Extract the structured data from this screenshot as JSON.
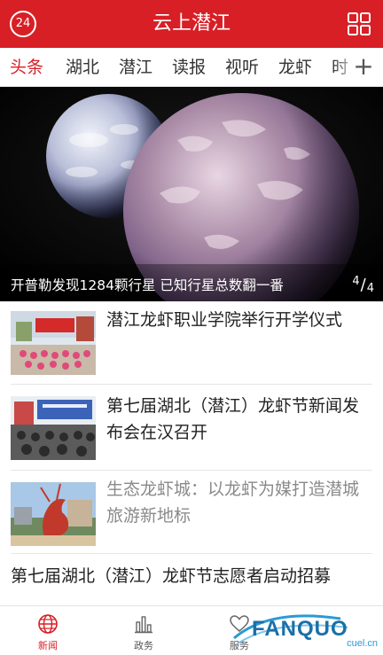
{
  "header": {
    "title": "云上潜江",
    "badge": "24"
  },
  "tabs": [
    "头条",
    "湖北",
    "潜江",
    "读报",
    "视听",
    "龙虾",
    "时"
  ],
  "banner": {
    "caption": "开普勒发现1284颗行星 已知行星总数翻一番",
    "page_current": "4",
    "page_total": "4"
  },
  "news": [
    {
      "title": "潜江龙虾职业学院举行开学仪式"
    },
    {
      "title": "第七届湖北（潜江）龙虾节新闻发布会在汉召开"
    },
    {
      "title": "生态龙虾城：以龙虾为媒打造潜城旅游新地标"
    },
    {
      "title": "第七届湖北（潜江）龙虾节志愿者启动招募"
    }
  ],
  "bottom_nav": [
    {
      "label": "新闻",
      "icon": "globe-icon",
      "active": true
    },
    {
      "label": "政务",
      "icon": "bar-chart-icon",
      "active": false
    },
    {
      "label": "服务",
      "icon": "heart-icon",
      "active": false
    }
  ],
  "watermark": {
    "text": "FANQUO",
    "sub": "cuel.cn"
  },
  "colors": {
    "brand": "#d81f26"
  }
}
